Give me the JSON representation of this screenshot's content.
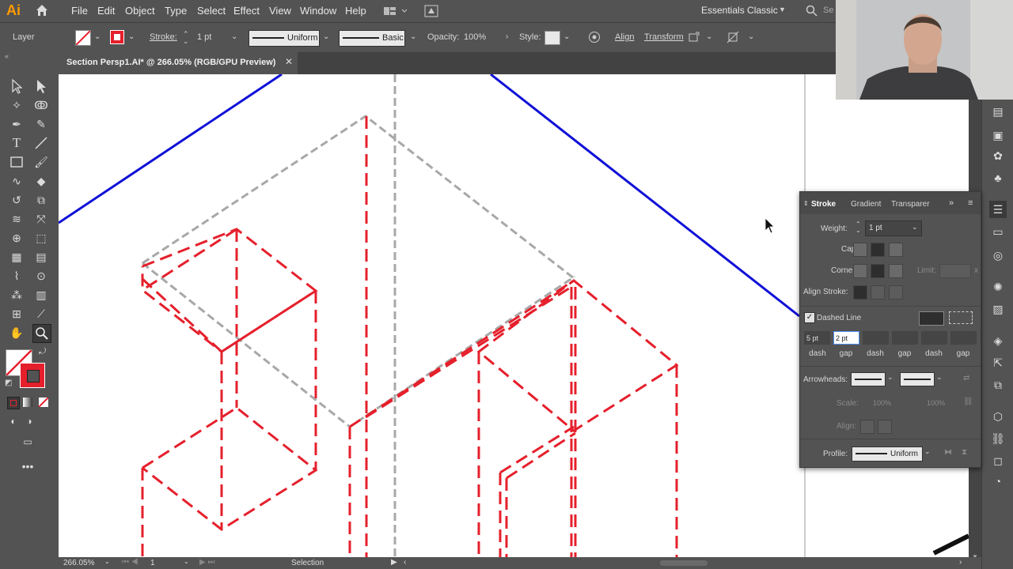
{
  "app": {
    "logo": "Ai",
    "workspace": "Essentials Classic",
    "search_placeholder": "Se"
  },
  "menu": [
    "File",
    "Edit",
    "Object",
    "Type",
    "Select",
    "Effect",
    "View",
    "Window",
    "Help"
  ],
  "control_bar": {
    "selection_label": "Layer",
    "stroke_label": "Stroke:",
    "stroke_value": "1 pt",
    "profile1": "Uniform",
    "profile2": "Basic",
    "opacity_label": "Opacity:",
    "opacity_value": "100%",
    "style_label": "Style:",
    "align_label": "Align",
    "transform_label": "Transform"
  },
  "document": {
    "tab_title": "Section Persp1.AI* @ 266.05% (RGB/GPU Preview)",
    "close": "✕"
  },
  "status": {
    "zoom": "266.05%",
    "artboard": "1",
    "tool": "Selection"
  },
  "stroke_panel": {
    "tabs": [
      "Stroke",
      "Gradient",
      "Transparer"
    ],
    "weight_label": "Weight:",
    "weight_value": "1 pt",
    "cap_label": "Cap:",
    "corner_label": "Corner:",
    "limit_label": "Limit:",
    "limit_x": "x",
    "align_label": "Align Stroke:",
    "dashed_label": "Dashed Line",
    "dashed_checked": true,
    "dash_values": [
      "5 pt",
      "2 pt",
      "",
      "",
      "",
      ""
    ],
    "dash_labels": [
      "dash",
      "gap",
      "dash",
      "gap",
      "dash",
      "gap"
    ],
    "arrowheads_label": "Arrowheads:",
    "scale_label": "Scale:",
    "scale_values": [
      "100%",
      "100%"
    ],
    "align_arrow_label": "Align:",
    "profile_label": "Profile:",
    "profile_value": "Uniform"
  },
  "colors": {
    "accent_red": "#e5202c",
    "blue_line": "#1010d8",
    "gray_dash": "#a8a8a8",
    "canvas": "#ffffff",
    "ui_bg": "#535353"
  }
}
